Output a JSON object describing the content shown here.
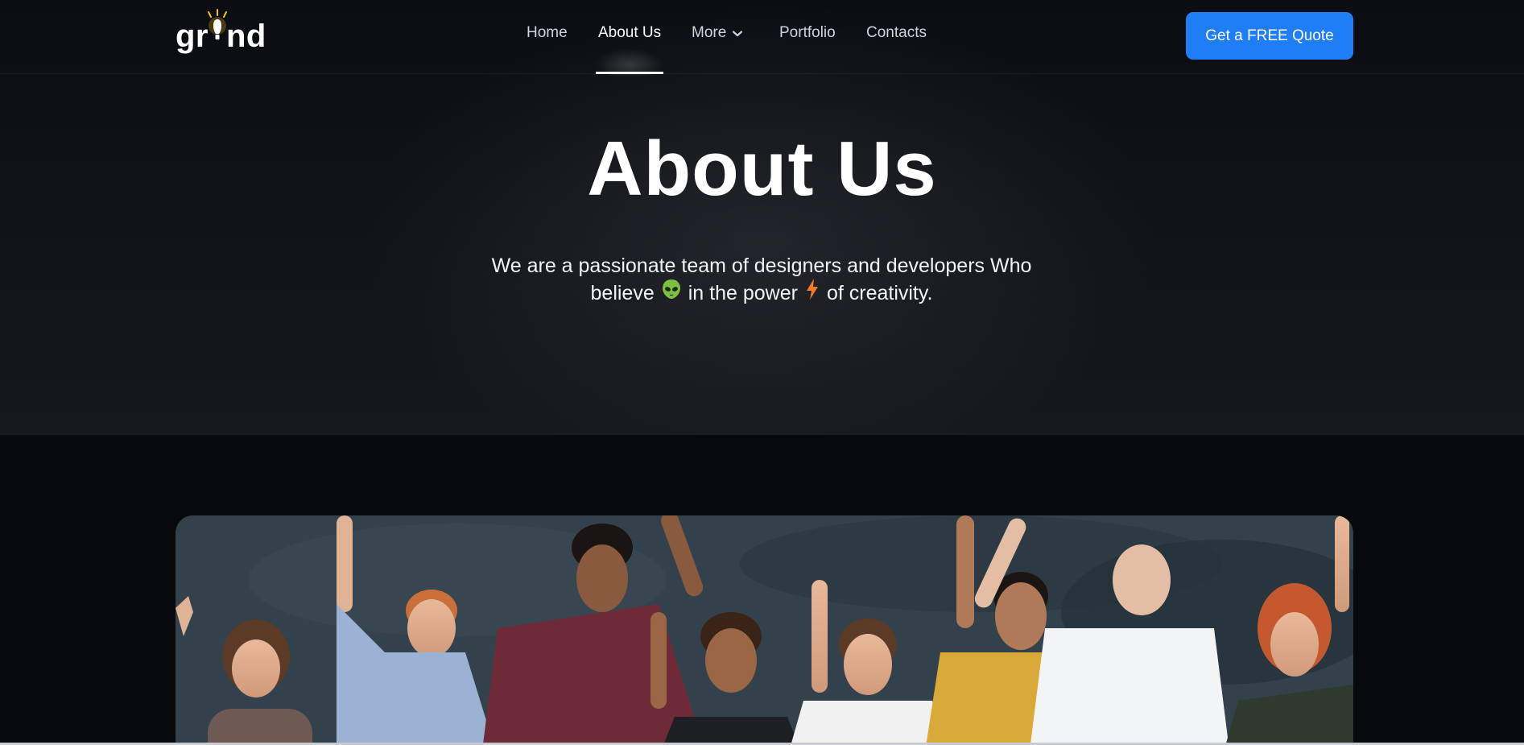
{
  "header": {
    "logo_text_left": "gr",
    "logo_text_right": "nd",
    "nav": [
      {
        "label": "Home"
      },
      {
        "label": "About Us",
        "active": true
      },
      {
        "label": "More"
      },
      {
        "label": "Portfolio"
      },
      {
        "label": "Contacts"
      }
    ],
    "cta_label": "Get a FREE Quote"
  },
  "hero": {
    "title": "About Us",
    "subtitle_part1": "We are a passionate team of designers and developers Who",
    "subtitle_part2": "believe",
    "subtitle_part3": "in the power",
    "subtitle_part4": "of creativity.",
    "emoji_1": "alien-icon",
    "emoji_2": "lightning-icon"
  },
  "team_photo": {
    "icon": "team-photo-image"
  },
  "colors": {
    "background": "#07090d",
    "accent": "#1f7ef5",
    "text": "#ffffff"
  }
}
